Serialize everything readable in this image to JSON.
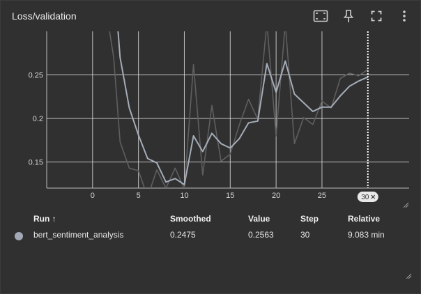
{
  "card": {
    "title": "Loss/validation",
    "toolbar": [
      {
        "name": "fit-domain-icon"
      },
      {
        "name": "pin-icon"
      },
      {
        "name": "fullscreen-icon"
      },
      {
        "name": "more-vert-icon"
      }
    ]
  },
  "chart_data": {
    "type": "line",
    "title": "",
    "xlabel": "",
    "ylabel": "",
    "xlim": [
      -5,
      34.5
    ],
    "ylim": [
      0.12,
      0.3
    ],
    "x_ticks": [
      0,
      5,
      10,
      15,
      20,
      25
    ],
    "x_tick_labels": [
      "0",
      "5",
      "10",
      "15",
      "20",
      "25"
    ],
    "y_ticks": [
      0.15,
      0.2,
      0.25
    ],
    "y_tick_labels": [
      "0.15",
      "0.2",
      "0.25"
    ],
    "grid": true,
    "hover_step": 30,
    "hover_label": "30",
    "series": [
      {
        "name": "",
        "role": "raw",
        "color": "#5f5f5f",
        "x": [
          1.7,
          2.3,
          3,
          4,
          5,
          6,
          7,
          8,
          9,
          10,
          11,
          12,
          13,
          14,
          15,
          16,
          17,
          18,
          19,
          20,
          21,
          22,
          23,
          24,
          25,
          26,
          27,
          28,
          29,
          30
        ],
        "y": [
          0.31,
          0.27,
          0.173,
          0.143,
          0.14,
          0.11,
          0.141,
          0.12,
          0.143,
          0.119,
          0.262,
          0.135,
          0.215,
          0.151,
          0.159,
          0.193,
          0.222,
          0.199,
          0.31,
          0.18,
          0.31,
          0.171,
          0.201,
          0.193,
          0.22,
          0.212,
          0.246,
          0.252,
          0.249,
          0.2563
        ]
      },
      {
        "name": "",
        "role": "smoothed",
        "color": "#a4adb9",
        "x": [
          2.7,
          3,
          4,
          5,
          6,
          7,
          8,
          9,
          10,
          11,
          12,
          13,
          14,
          15,
          16,
          17,
          18,
          19,
          20,
          21,
          22,
          23,
          24,
          25,
          26,
          27,
          28,
          29,
          30
        ],
        "y": [
          0.31,
          0.27,
          0.212,
          0.181,
          0.154,
          0.149,
          0.127,
          0.131,
          0.124,
          0.18,
          0.162,
          0.183,
          0.171,
          0.166,
          0.177,
          0.195,
          0.197,
          0.263,
          0.23,
          0.266,
          0.228,
          0.218,
          0.208,
          0.213,
          0.213,
          0.226,
          0.237,
          0.243,
          0.2475
        ]
      }
    ]
  },
  "table": {
    "headers": {
      "run": "Run ↑",
      "smoothed": "Smoothed",
      "value": "Value",
      "step": "Step",
      "relative": "Relative"
    },
    "rows": [
      {
        "color": "#a2a9b4",
        "run": "bert_sentiment_analysis",
        "smoothed": "0.2475",
        "value": "0.2563",
        "step": "30",
        "relative": "9.083 min"
      }
    ]
  }
}
